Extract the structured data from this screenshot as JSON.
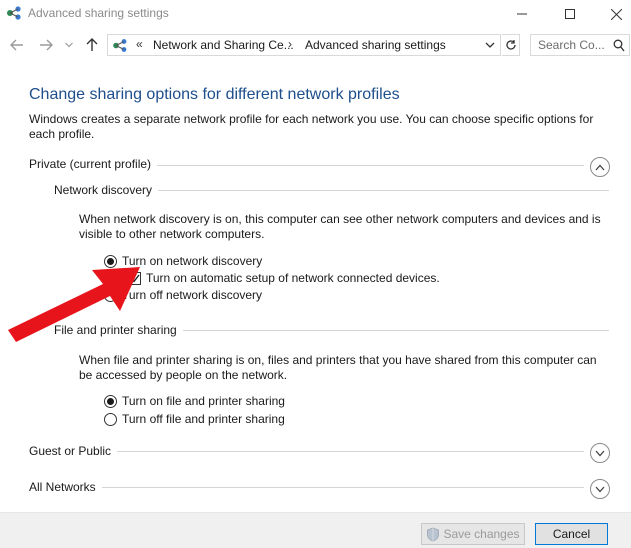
{
  "window": {
    "title": "Advanced sharing settings"
  },
  "address": {
    "chevrons": "«",
    "crumb1": "Network and Sharing Ce...",
    "separator": "›",
    "crumb2": "Advanced sharing settings"
  },
  "search": {
    "placeholder": "Search Co..."
  },
  "content": {
    "heading": "Change sharing options for different network profiles",
    "intro": "Windows creates a separate network profile for each network you use. You can choose specific options for each profile.",
    "private_profile": {
      "label": "Private (current profile)",
      "network_discovery": {
        "label": "Network discovery",
        "description": "When network discovery is on, this computer can see other network computers and devices and is visible to other network computers.",
        "option_on": "Turn on network discovery",
        "auto_setup": "Turn on automatic setup of network connected devices.",
        "option_off": "Turn off network discovery",
        "selected": "on",
        "auto_setup_checked": true
      },
      "file_printer_sharing": {
        "label": "File and printer sharing",
        "description": "When file and printer sharing is on, files and printers that you have shared from this computer can be accessed by people on the network.",
        "option_on": "Turn on file and printer sharing",
        "option_off": "Turn off file and printer sharing",
        "selected": "on"
      }
    },
    "guest_public": {
      "label": "Guest or Public"
    },
    "all_networks": {
      "label": "All Networks"
    }
  },
  "footer": {
    "save_label": "Save changes",
    "cancel_label": "Cancel"
  },
  "colors": {
    "heading": "#1e4e8c",
    "accent": "#0078d7",
    "annotation_arrow": "#e8141b"
  }
}
